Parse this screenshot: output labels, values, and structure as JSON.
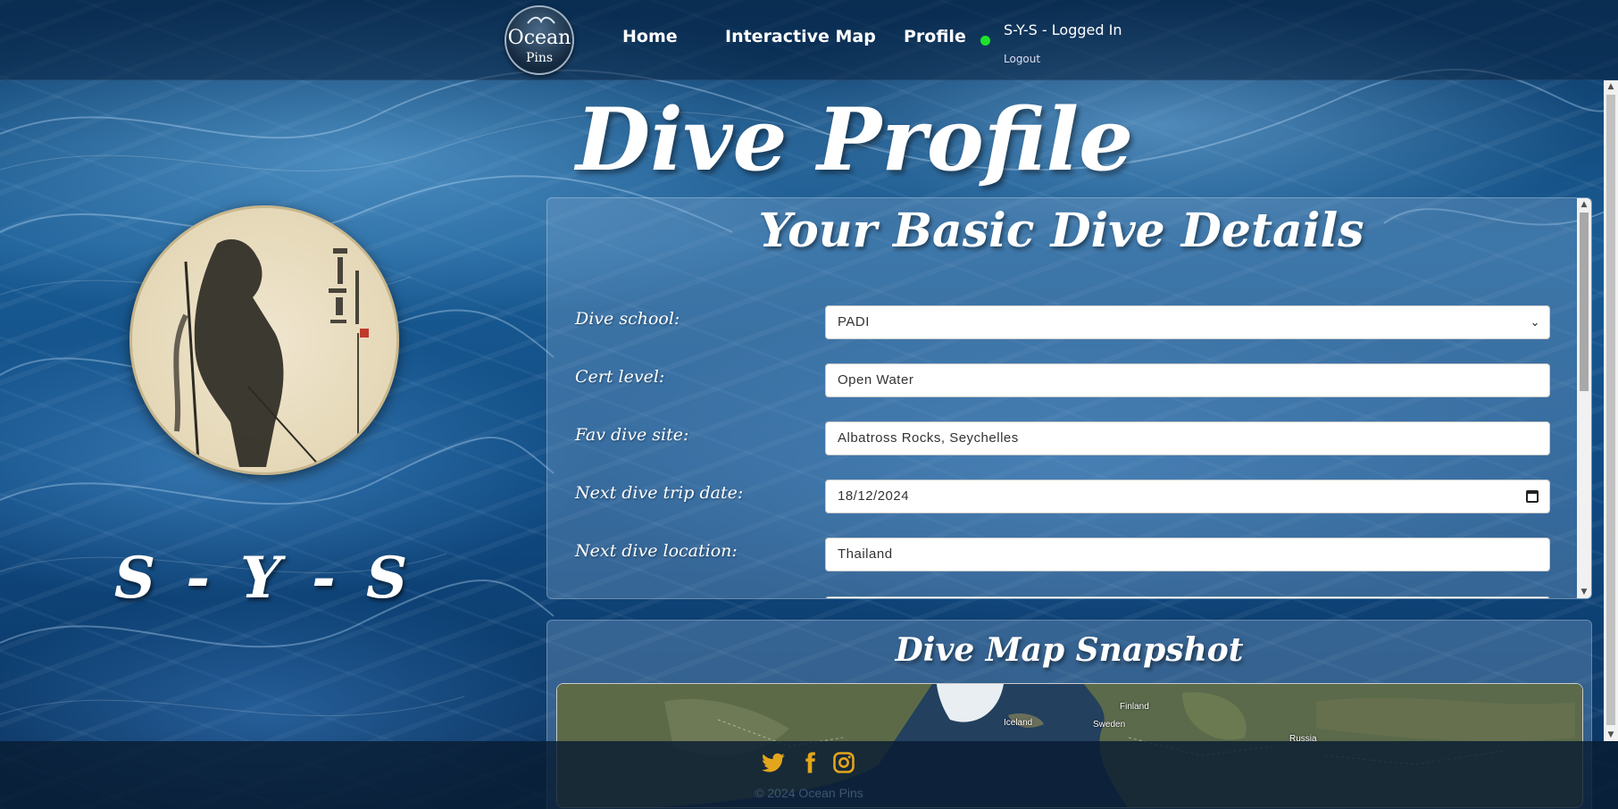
{
  "logo": {
    "line1": "Ocean",
    "line2": "Pins"
  },
  "nav": {
    "items": [
      {
        "label": "Home"
      },
      {
        "label": "Interactive Map"
      },
      {
        "label": "Profile"
      }
    ],
    "user_status": "S-Y-S - Logged In",
    "logout": "Logout",
    "status_color": "#1ee32a"
  },
  "page_title": "Dive Profile",
  "profile": {
    "username": "S - Y - S"
  },
  "details": {
    "title": "Your Basic Dive Details",
    "rows": [
      {
        "label": "Dive school:",
        "value": "PADI",
        "type": "select"
      },
      {
        "label": "Cert level:",
        "value": "Open Water",
        "type": "text"
      },
      {
        "label": "Fav dive site:",
        "value": "Albatross Rocks, Seychelles",
        "type": "text"
      },
      {
        "label": "Next dive trip date:",
        "value": "18/12/2024",
        "type": "date"
      },
      {
        "label": "Next dive location:",
        "value": "Thailand",
        "type": "text"
      }
    ]
  },
  "map_section": {
    "title": "Dive Map Snapshot",
    "labels": [
      "Iceland",
      "Finland",
      "Sweden",
      "Russia"
    ]
  },
  "footer": {
    "social_icons": [
      "twitter-icon",
      "facebook-icon",
      "instagram-icon"
    ],
    "social_color": "#e3a51c",
    "copyright": "© 2024 Ocean Pins"
  }
}
